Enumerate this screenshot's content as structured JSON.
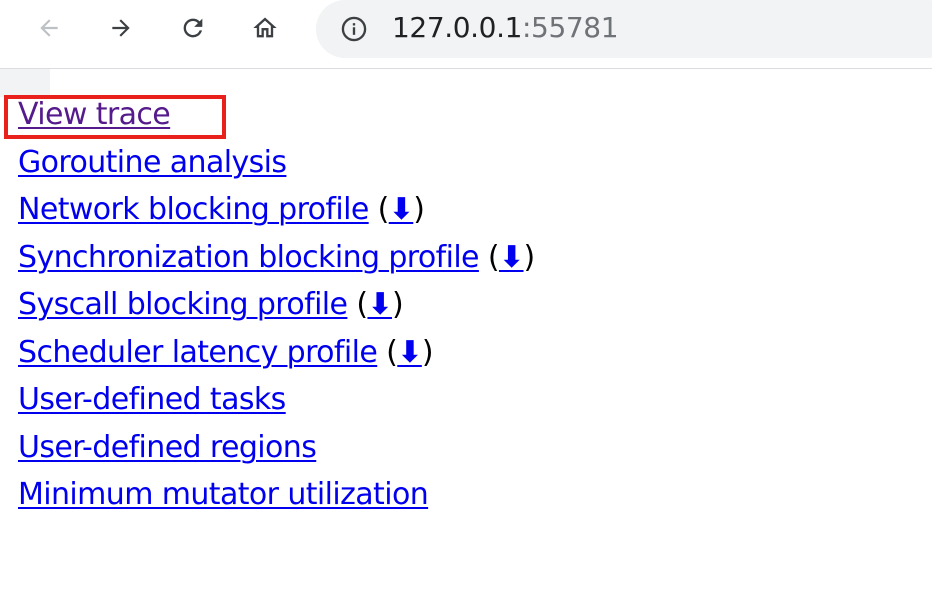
{
  "browser": {
    "back_icon": "arrow-left-icon",
    "forward_icon": "arrow-right-icon",
    "reload_icon": "reload-icon",
    "home_icon": "home-icon",
    "site_info_icon": "info-circle-icon",
    "url_host": "127.0.0.1",
    "url_port": ":55781"
  },
  "page": {
    "links": [
      {
        "label": "View trace",
        "visited": true
      },
      {
        "label": "Goroutine analysis"
      },
      {
        "label": "Network blocking profile",
        "download": "⬇"
      },
      {
        "label": "Synchronization blocking profile",
        "download": "⬇"
      },
      {
        "label": "Syscall blocking profile",
        "download": "⬇"
      },
      {
        "label": "Scheduler latency profile",
        "download": "⬇"
      },
      {
        "label": "User-defined tasks"
      },
      {
        "label": "User-defined regions"
      },
      {
        "label": "Minimum mutator utilization"
      }
    ],
    "paren_open": "(",
    "paren_close": ")"
  },
  "colors": {
    "link": "#0000ee",
    "visited_link": "#551a8b",
    "highlight": "#e8211c",
    "omnibox_bg": "#f1f3f4"
  }
}
